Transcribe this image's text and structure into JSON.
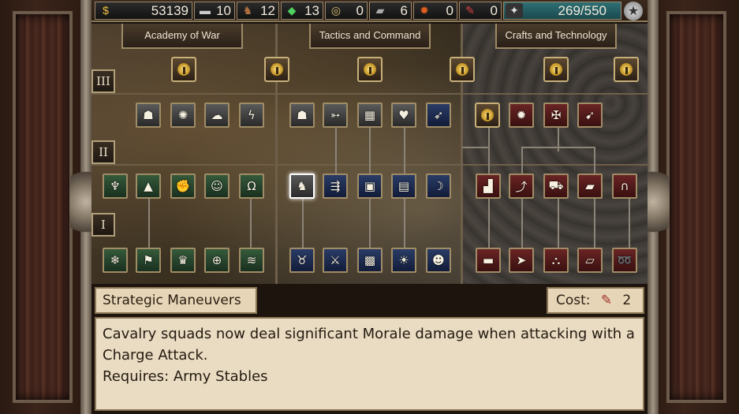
{
  "resources": [
    {
      "icon": "gold-coins-icon",
      "glyph": "$",
      "value": "53139"
    },
    {
      "icon": "iron-ingot-icon",
      "glyph": "▬",
      "value": "10"
    },
    {
      "icon": "horse-icon",
      "glyph": "♞",
      "value": "12"
    },
    {
      "icon": "gems-icon",
      "glyph": "◆",
      "value": "13"
    },
    {
      "icon": "medal-icon",
      "glyph": "◎",
      "value": "0"
    },
    {
      "icon": "cannon-icon",
      "glyph": "▰",
      "value": "6"
    },
    {
      "icon": "fire-icon",
      "glyph": "✹",
      "value": "0"
    },
    {
      "icon": "scroll-icon",
      "glyph": "✎",
      "value": "0"
    },
    {
      "icon": "eagle-icon",
      "glyph": "✦",
      "value": "269/550"
    }
  ],
  "tabs": [
    "Academy of War",
    "Tactics and Command",
    "Crafts and Technology"
  ],
  "rows": [
    "III",
    "II",
    "I"
  ],
  "selected": {
    "title": "Strategic Maneuvers",
    "cost_label": "Cost:",
    "cost_value": "2",
    "description": "Cavalry squads now deal significant Morale damage when attacking with a Charge Attack.",
    "requires": "Requires: Army Stables"
  },
  "colors": {
    "accent": "#c8b07a",
    "panel": "#e6d5b6",
    "teal": "#2e6f74"
  },
  "skills": {
    "academy": {
      "tier3": [
        "knight-helmet-icon",
        "whirlwind-icon",
        "smoke-icon",
        "lightning-icon"
      ],
      "tier2": [
        "dragon-icon",
        "wizard-hat-icon",
        "armored-fist-icon",
        "maiden-icon",
        "golden-ring-icon"
      ],
      "tier1": [
        "snowflake-icon",
        "banner-icon",
        "crown-icon",
        "crosshair-icon",
        "wave-icon"
      ]
    },
    "tactics": {
      "tier3": [
        "gladiator-helmet-icon",
        "arrow-scroll-icon",
        "map-icon",
        "heart-icon",
        "spear-charge-icon"
      ],
      "tier2": [
        "strategic-maneuvers-icon",
        "arrows-volley-icon",
        "blueprint-icon",
        "document-icon",
        "bow-icon"
      ],
      "tier1": [
        "bear-icon",
        "crossed-swords-icon",
        "shield-map-icon",
        "sun-medal-icon",
        "soldier-icon"
      ]
    },
    "crafts": {
      "tier3": [
        "explosion-icon",
        "crossbow-icon",
        "ballista-icon"
      ],
      "tier2": [
        "anvil-icon",
        "catapult-icon",
        "siege-cart-icon",
        "forge-icon",
        "gate-icon"
      ],
      "tier1": [
        "cannon-piece-icon",
        "arrowhead-icon",
        "mortar-icon",
        "ingot-icon",
        "rope-icon"
      ]
    }
  }
}
